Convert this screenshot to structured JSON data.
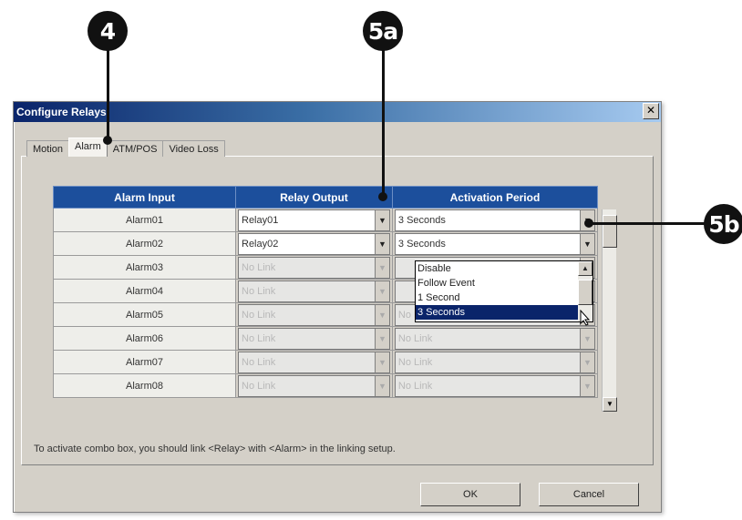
{
  "callouts": [
    {
      "label": "4"
    },
    {
      "label": "5a"
    },
    {
      "label": "5b"
    }
  ],
  "window": {
    "title": "Configure Relays",
    "close_glyph": "✕"
  },
  "tabs": [
    {
      "label": "Motion",
      "active": false
    },
    {
      "label": "Alarm",
      "active": true
    },
    {
      "label": "ATM/POS",
      "active": false
    },
    {
      "label": "Video Loss",
      "active": false
    }
  ],
  "table": {
    "headers": [
      "Alarm Input",
      "Relay Output",
      "Activation Period"
    ],
    "rows": [
      {
        "input": "Alarm01",
        "relay": "Relay01",
        "period": "3 Seconds",
        "enabled": true
      },
      {
        "input": "Alarm02",
        "relay": "Relay02",
        "period": "3 Seconds",
        "enabled": true
      },
      {
        "input": "Alarm03",
        "relay": "No Link",
        "period": "",
        "enabled": false
      },
      {
        "input": "Alarm04",
        "relay": "No Link",
        "period": "",
        "enabled": false
      },
      {
        "input": "Alarm05",
        "relay": "No Link",
        "period": "No Link",
        "enabled": false
      },
      {
        "input": "Alarm06",
        "relay": "No Link",
        "period": "No Link",
        "enabled": false
      },
      {
        "input": "Alarm07",
        "relay": "No Link",
        "period": "No Link",
        "enabled": false
      },
      {
        "input": "Alarm08",
        "relay": "No Link",
        "period": "No Link",
        "enabled": false
      }
    ]
  },
  "dropdown": {
    "options": [
      "Disable",
      "Follow Event",
      "1 Second",
      "3 Seconds"
    ],
    "selected": "3 Seconds"
  },
  "icons": {
    "combo_arrow": "▼",
    "scroll_up": "▲",
    "scroll_down": "▼"
  },
  "note": "To activate combo box, you should link <Relay> with <Alarm> in the linking setup.",
  "buttons": {
    "ok": "OK",
    "cancel": "Cancel"
  },
  "colors": {
    "header_bg": "#1c4f9c",
    "selection": "#0a246a"
  }
}
